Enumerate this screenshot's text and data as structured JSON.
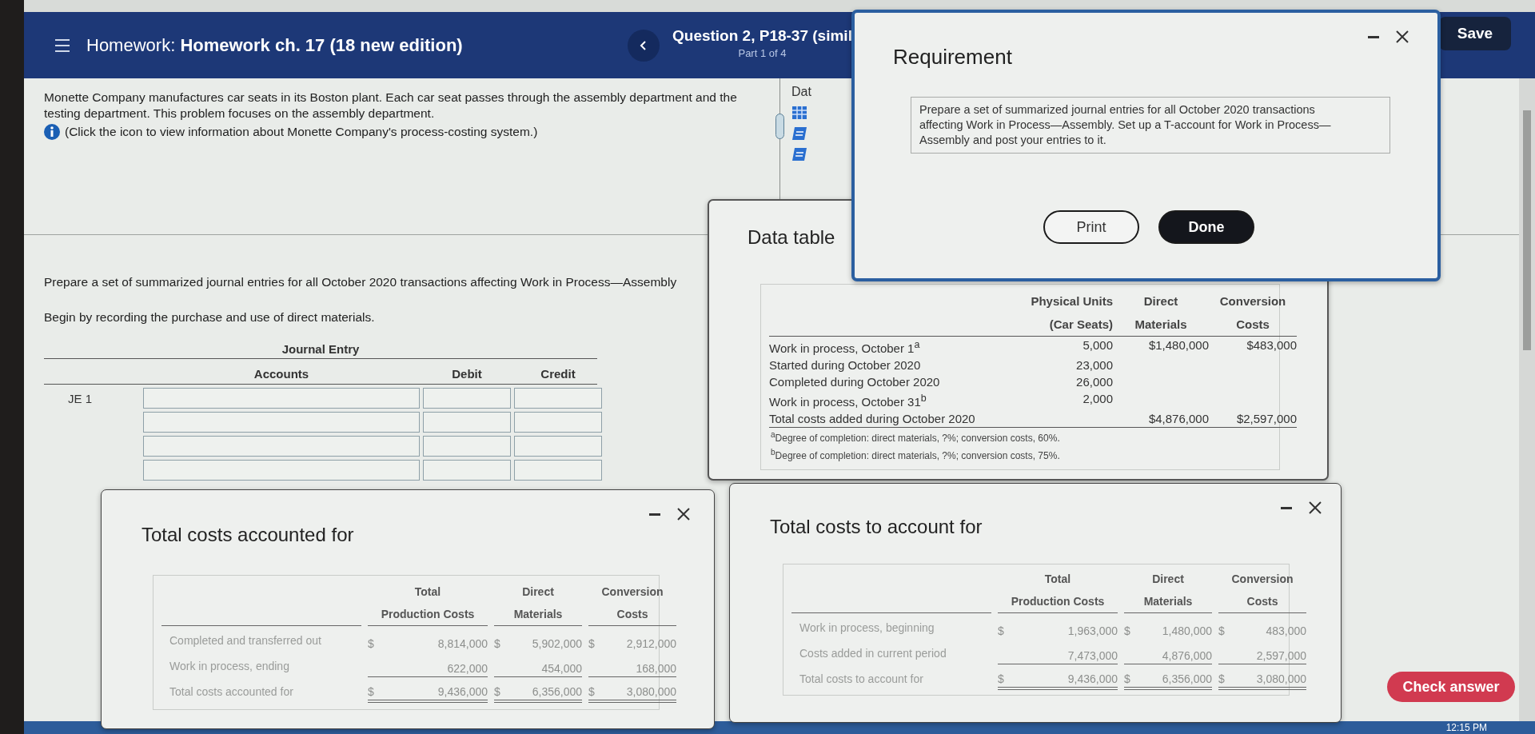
{
  "header": {
    "label": "Homework:",
    "title": "Homework ch. 17 (18 new edition)",
    "question": "Question 2, P18-37 (simil",
    "part": "Part 1 of 4",
    "save": "Save"
  },
  "problem": {
    "intro": "Monette Company manufactures car seats in its Boston plant. Each car seat passes through the assembly department and the testing department. This problem focuses on the assembly department.",
    "info": "(Click the icon to view information about Monette Company's process-costing system.)"
  },
  "side_panel": {
    "label": "Dat"
  },
  "instructions": [
    "Prepare a set of summarized journal entries for all October 2020 transactions affecting Work in Process—Assembly",
    "Begin by recording the purchase and use of direct materials."
  ],
  "journal": {
    "title": "Journal Entry",
    "columns": [
      "Accounts",
      "Debit",
      "Credit"
    ],
    "rows": [
      {
        "kind": "labeled",
        "label": "JE 1"
      },
      {
        "kind": "blank"
      },
      {
        "kind": "blank"
      },
      {
        "kind": "blank"
      }
    ]
  },
  "data_table": {
    "title": "Data table",
    "columns": [
      {
        "line1": "Physical Units",
        "line2": "(Car Seats)"
      },
      {
        "line1": "Direct",
        "line2": "Materials"
      },
      {
        "line1": "Conversion",
        "line2": "Costs"
      }
    ],
    "rows": [
      {
        "label": "Work in process, October 1$^{a}$",
        "units": "5,000",
        "materials": "$1,480,000",
        "conversion": "$483,000"
      },
      {
        "label": "Started during October 2020",
        "units": "23,000"
      },
      {
        "label": "Completed during October 2020",
        "units": "26,000"
      },
      {
        "label": "Work in process, October 31$^{b}$",
        "units": "2,000"
      },
      {
        "label": "Total costs added during October 2020",
        "materials": "$4,876,000",
        "conversion": "$2,597,000"
      }
    ],
    "footnotes": [
      "$^{a}$Degree of completion: direct materials, ?%; conversion costs, 60%.",
      "$^{b}$Degree of completion: direct materials, ?%; conversion costs, 75%."
    ]
  },
  "requirement": {
    "title": "Requirement",
    "text": "Prepare a set of summarized journal entries for all October 2020 transactions affecting Work in Process—Assembly. Set up a T-account for Work in Process—Assembly and post your entries to it.",
    "buttons": [
      {
        "label": "Print",
        "kind": "outline"
      },
      {
        "label": "Done",
        "kind": "primary"
      }
    ]
  },
  "costs_accounted": {
    "title": "Total costs accounted for",
    "columns": [
      {
        "line1": "Total",
        "line2": "Production Costs"
      },
      {
        "line1": "Direct",
        "line2": "Materials"
      },
      {
        "line1": "Conversion",
        "line2": "Costs"
      }
    ],
    "rows": [
      {
        "label": "Completed and transferred out",
        "kind": "first",
        "cells": [
          {
            "sign": "$",
            "value": "8,814,000"
          },
          {
            "sign": "$",
            "value": "5,902,000"
          },
          {
            "sign": "$",
            "value": "2,912,000"
          }
        ]
      },
      {
        "label": "Work in process, ending",
        "kind": "subtotal",
        "cells": [
          {
            "value": "622,000"
          },
          {
            "value": "454,000"
          },
          {
            "value": "168,000"
          }
        ]
      },
      {
        "label": "Total costs accounted for",
        "kind": "total",
        "cells": [
          {
            "sign": "$",
            "value": "9,436,000"
          },
          {
            "sign": "$",
            "value": "6,356,000"
          },
          {
            "sign": "$",
            "value": "3,080,000"
          }
        ]
      }
    ]
  },
  "costs_to_account": {
    "title": "Total costs to account for",
    "columns": [
      {
        "line1": "Total",
        "line2": "Production Costs"
      },
      {
        "line1": "Direct",
        "line2": "Materials"
      },
      {
        "line1": "Conversion",
        "line2": "Costs"
      }
    ],
    "rows": [
      {
        "label": "Work in process, beginning",
        "kind": "first",
        "cells": [
          {
            "sign": "$",
            "value": "1,963,000"
          },
          {
            "sign": "$",
            "value": "1,480,000"
          },
          {
            "sign": "$",
            "value": "483,000"
          }
        ]
      },
      {
        "label": "Costs added in current period",
        "kind": "subtotal",
        "cells": [
          {
            "value": "7,473,000"
          },
          {
            "value": "4,876,000"
          },
          {
            "value": "2,597,000"
          }
        ]
      },
      {
        "label": "Total costs to account for",
        "kind": "total",
        "cells": [
          {
            "sign": "$",
            "value": "9,436,000"
          },
          {
            "sign": "$",
            "value": "6,356,000"
          },
          {
            "sign": "$",
            "value": "3,080,000"
          }
        ]
      }
    ]
  },
  "check_answer": "Check answer",
  "clock": "12:15 PM"
}
